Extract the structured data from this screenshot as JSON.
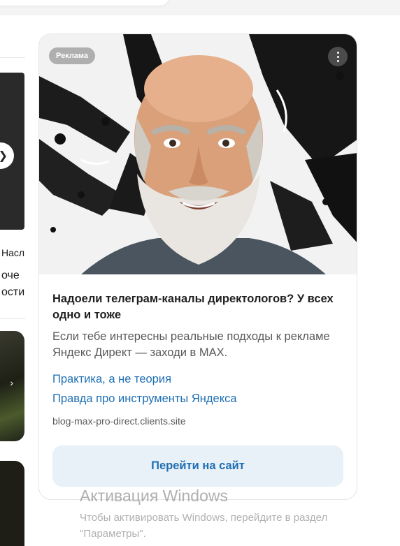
{
  "ad": {
    "label": "Реклама",
    "title": "Надоели телеграм-каналы директологов? У всех одно и тоже",
    "text": "Если тебе интересны реальные подходы к рекламе Яндекс Директ — заходи в MAX.",
    "links": [
      "Практика, а не теория",
      "Правда про инструменты Яндекса"
    ],
    "domain": "blog-max-pro-direct.clients.site",
    "button": "Перейти на сайт"
  },
  "left_column": {
    "text_line1": "Насл",
    "text_line2": "оче",
    "text_line3": "ости"
  },
  "watermark": {
    "title": "Активация Windows",
    "subtitle_line1": "Чтобы активировать Windows, перейдите в раздел",
    "subtitle_line2": "\"Параметры\"."
  },
  "colors": {
    "link": "#1f6fb2",
    "button_bg": "#e8f0f8",
    "card_border": "#e4e4e8"
  }
}
